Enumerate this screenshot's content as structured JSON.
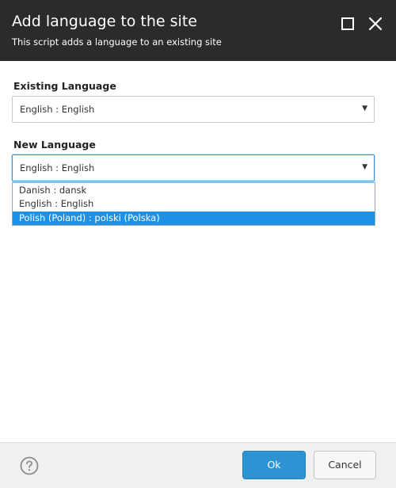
{
  "dialog": {
    "title": "Add language to the site",
    "subtitle": "This script adds a language to an existing site",
    "maximize_icon": "maximize-icon",
    "close_icon": "close-icon"
  },
  "existing_language": {
    "label": "Existing Language",
    "value": "English : English"
  },
  "new_language": {
    "label": "New Language",
    "value": "English : English",
    "options": [
      "Danish : dansk",
      "English : English",
      "Polish (Poland) : polski (Polska)"
    ],
    "highlighted_option": "Polish (Poland) : polski (Polska)"
  },
  "footer": {
    "help_icon": "help-icon",
    "ok_label": "Ok",
    "cancel_label": "Cancel"
  },
  "colors": {
    "header_bg": "#2b2b2b",
    "accent": "#2d93d2",
    "highlight": "#1e90e6"
  }
}
